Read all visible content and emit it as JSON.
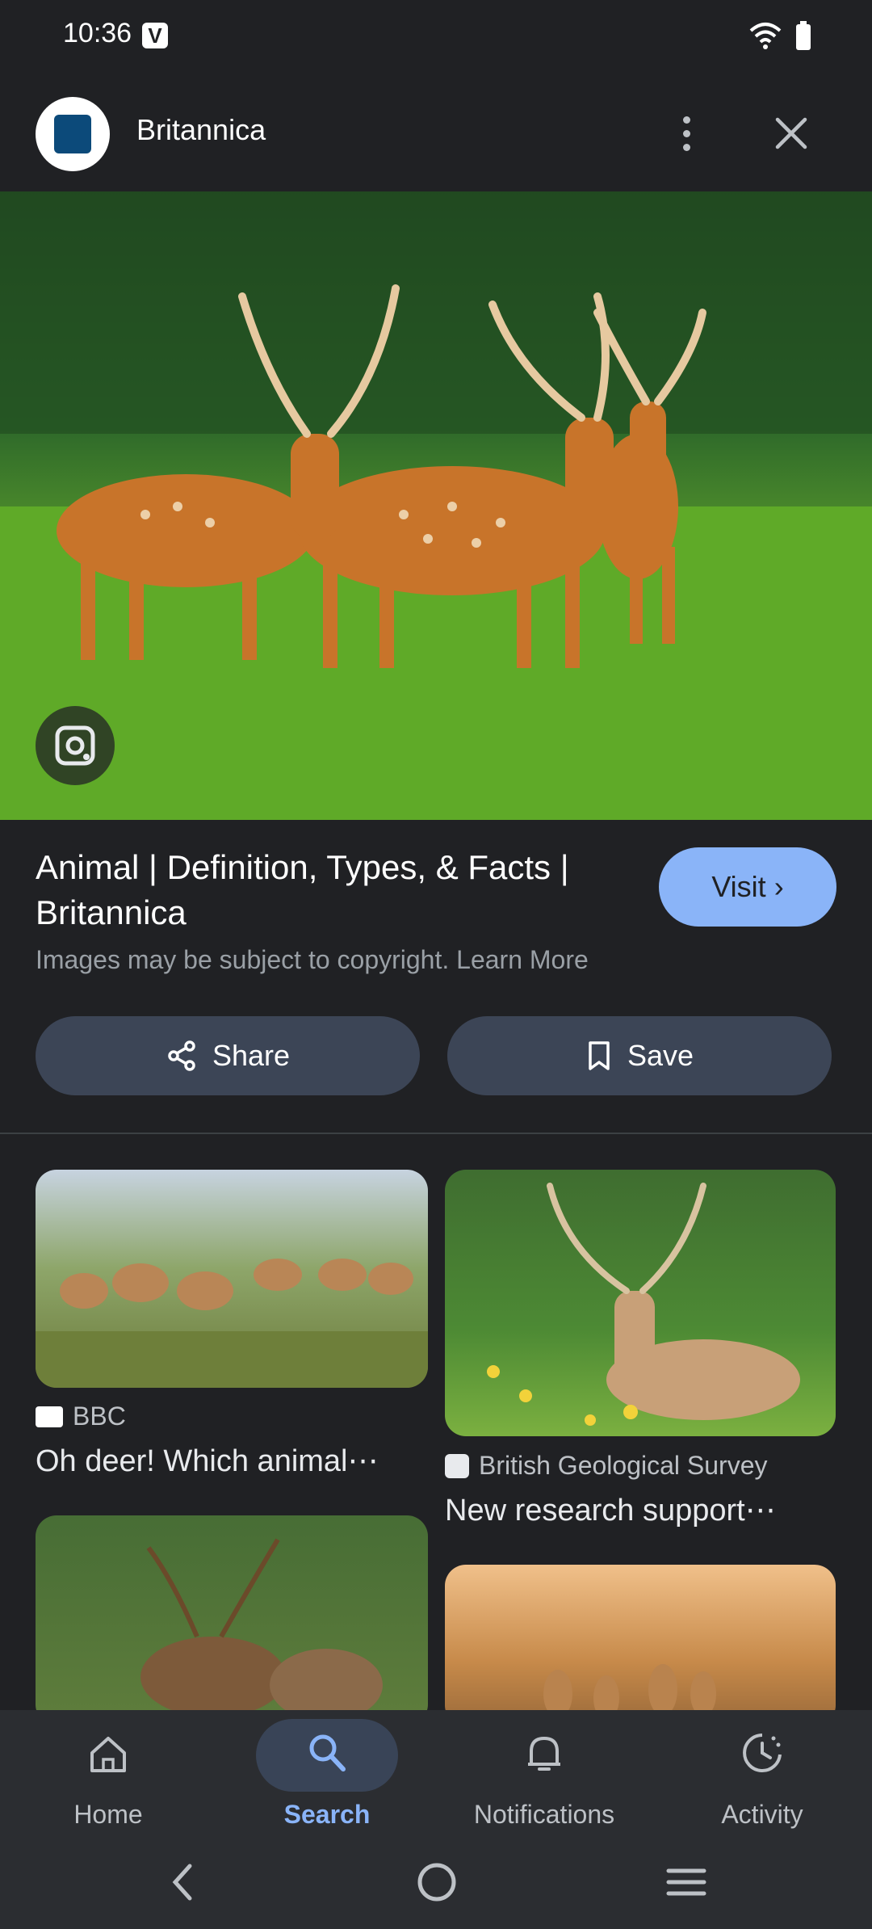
{
  "status": {
    "time": "10:36",
    "badge": "V"
  },
  "header": {
    "site_name": "Britannica"
  },
  "result": {
    "title": "Animal | Definition, Types, & Facts | Britannica",
    "visit_label": "Visit",
    "copyright": "Images may be subject to copyright.",
    "learn_more": "Learn More",
    "share_label": "Share",
    "save_label": "Save"
  },
  "related": [
    {
      "source": "BBC",
      "title": "Oh deer! Which animal⋯"
    },
    {
      "source": "British Geological Survey",
      "title": "New research support⋯"
    }
  ],
  "nav": {
    "items": [
      {
        "label": "Home"
      },
      {
        "label": "Search"
      },
      {
        "label": "Notifications"
      },
      {
        "label": "Activity"
      }
    ]
  },
  "colors": {
    "accent": "#8ab4f8",
    "background": "#202124",
    "pill": "#3c4556"
  }
}
